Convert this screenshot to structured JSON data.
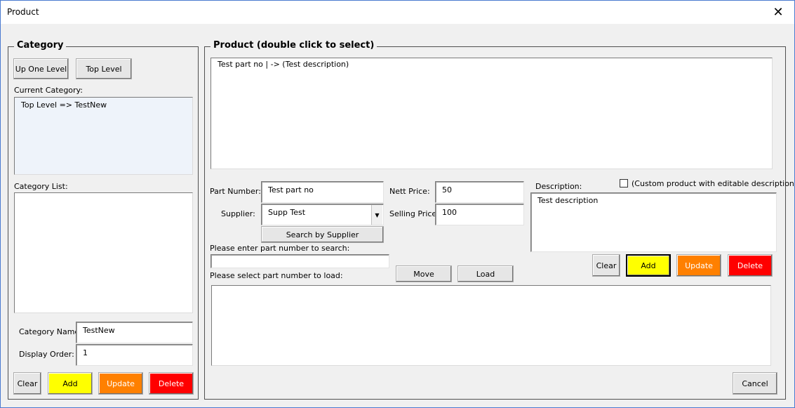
{
  "window": {
    "title": "Product",
    "close_glyph": "✕"
  },
  "category": {
    "frame_title": "Category",
    "up_one_level": "Up One Level",
    "top_level": "Top Level",
    "current_category_label": "Current Category:",
    "current_category_value": "Top Level => TestNew",
    "category_list_label": "Category List:",
    "category_list_items": [],
    "category_name_label": "Category Name:",
    "category_name_value": "TestNew",
    "display_order_label": "Display Order:",
    "display_order_value": "1",
    "buttons": {
      "clear": "Clear",
      "add": "Add",
      "update": "Update",
      "delete": "Delete"
    }
  },
  "product": {
    "frame_title": "Product (double click to select)",
    "list_items": [
      "Test part no | -> (Test description)"
    ],
    "part_number_label": "Part Number:",
    "part_number_value": "Test part no",
    "supplier_label": "Supplier:",
    "supplier_value": "Supp Test",
    "search_by_supplier": "Search by Supplier",
    "nett_price_label": "Nett Price:",
    "nett_price_value": "50",
    "selling_price_label": "Selling Price:",
    "selling_price_value": "100",
    "description_label": "Description:",
    "custom_product_label": "(Custom product with editable description)",
    "description_value": "Test description",
    "search_prompt": "Please enter part number to search:",
    "search_value": "",
    "select_prompt": "Please select part number to load:",
    "move_button": "Move",
    "load_button": "Load",
    "buttons": {
      "clear": "Clear",
      "add": "Add",
      "update": "Update",
      "delete": "Delete"
    },
    "cancel_button": "Cancel"
  },
  "colors": {
    "add": "#ffff00",
    "update": "#ff8000",
    "delete": "#ff0000",
    "window_border": "#4a7ad0"
  },
  "icons": {
    "close": "close-icon",
    "dropdown": "chevron-down-icon",
    "checkbox": "checkbox-icon"
  }
}
